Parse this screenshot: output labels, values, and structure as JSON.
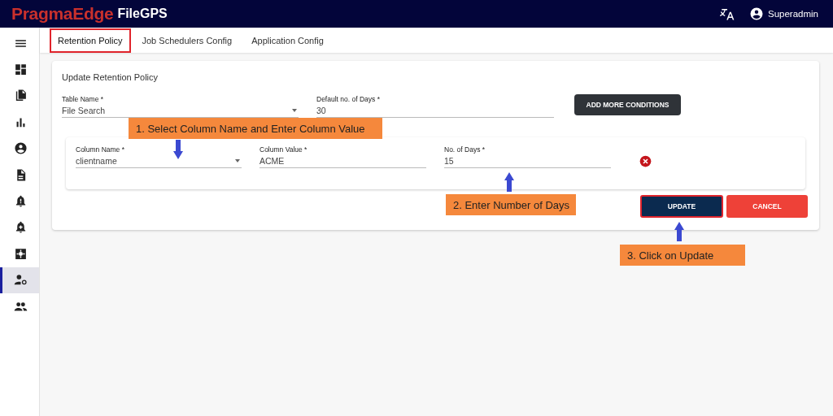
{
  "header": {
    "brand": "PragmaEdge",
    "product": "FileGPS",
    "user": "Superadmin"
  },
  "sidebar": {
    "items": [
      {
        "kind": "menu",
        "selected": false
      },
      {
        "kind": "dashboard",
        "selected": false
      },
      {
        "kind": "files",
        "selected": false
      },
      {
        "kind": "chart",
        "selected": false
      },
      {
        "kind": "account",
        "selected": false
      },
      {
        "kind": "document",
        "selected": false
      },
      {
        "kind": "bell",
        "selected": false
      },
      {
        "kind": "bell-plus",
        "selected": false
      },
      {
        "kind": "gear-box",
        "selected": false
      },
      {
        "kind": "user-gear",
        "selected": true
      },
      {
        "kind": "people",
        "selected": false
      }
    ]
  },
  "tabs": [
    {
      "label": "Retention Policy",
      "selected": true,
      "highlighted": true
    },
    {
      "label": "Job Schedulers Config",
      "selected": false,
      "highlighted": false
    },
    {
      "label": "Application Config",
      "selected": false,
      "highlighted": false
    }
  ],
  "form": {
    "title": "Update Retention Policy",
    "table_name": {
      "label": "Table Name *",
      "value": "File Search"
    },
    "default_days": {
      "label": "Default no. of Days *",
      "value": "30"
    },
    "add_button": "ADD MORE CONDITIONS",
    "conditions": [
      {
        "column_name": {
          "label": "Column Name *",
          "value": "clientname"
        },
        "column_value": {
          "label": "Column Value *",
          "value": "ACME"
        },
        "days": {
          "label": "No. of Days *",
          "value": "15"
        }
      }
    ],
    "update_button": {
      "label": "UPDATE",
      "highlighted": true
    },
    "cancel_button": {
      "label": "CANCEL",
      "highlighted": false
    }
  },
  "annotations": [
    {
      "text": "1. Select Column Name and Enter Column Value",
      "kind": "down"
    },
    {
      "text": "2. Enter Number of Days",
      "kind": "up"
    },
    {
      "text": "3. Click on Update",
      "kind": "up"
    }
  ]
}
